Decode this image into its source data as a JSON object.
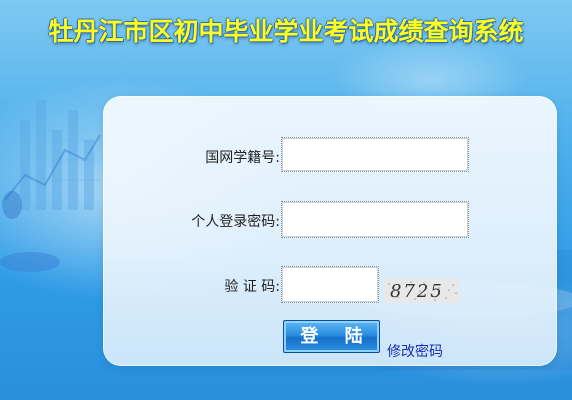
{
  "header": {
    "title": "牡丹江市区初中毕业学业考试成绩查询系统"
  },
  "form": {
    "student_id": {
      "label": "国网学籍号:",
      "value": "",
      "placeholder": ""
    },
    "password": {
      "label": "个人登录密码:",
      "value": "",
      "placeholder": ""
    },
    "verify": {
      "label": "验 证 码:",
      "value": "",
      "placeholder": "",
      "captcha_text": "8725"
    },
    "login_button": "登 陆",
    "change_password_link": "修改密码"
  },
  "colors": {
    "title": "#ffff1a",
    "link": "#1a2fb4",
    "background": "#4fb0ec"
  }
}
